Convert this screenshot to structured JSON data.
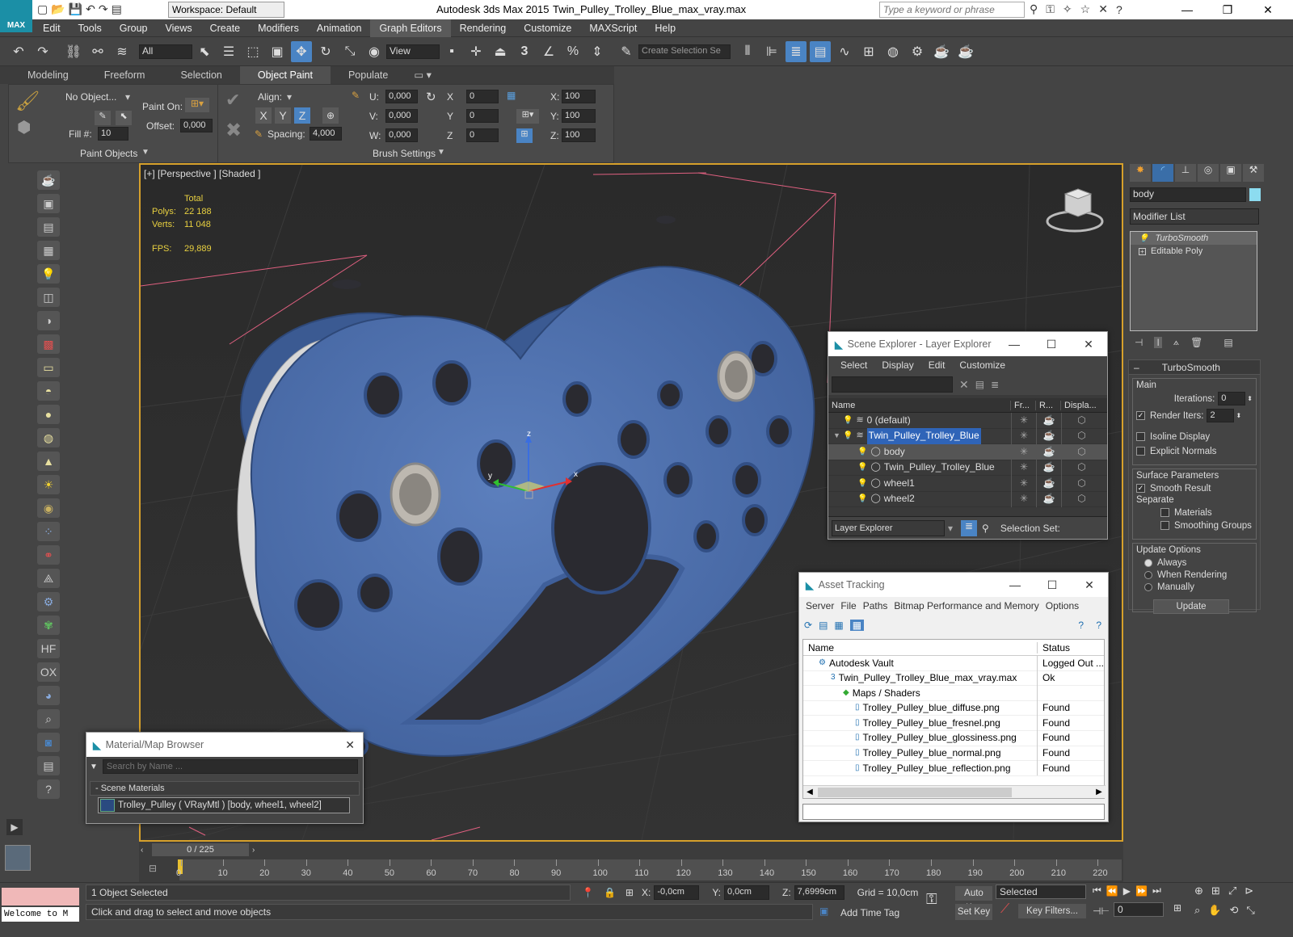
{
  "title_bar": {
    "workspace_label": "Workspace: Default",
    "app_title": "Autodesk 3ds Max  2015",
    "file_title": "Twin_Pulley_Trolley_Blue_max_vray.max",
    "search_placeholder": "Type a keyword or phrase"
  },
  "menu": [
    "Edit",
    "Tools",
    "Group",
    "Views",
    "Create",
    "Modifiers",
    "Animation",
    "Graph Editors",
    "Rendering",
    "Customize",
    "MAXScript",
    "Help"
  ],
  "menu_selected": "Graph Editors",
  "toolbar": {
    "selection_filter": "All",
    "ref_coord": "View",
    "create_selection_set": "Create Selection Se",
    "snap_3": "3"
  },
  "ribbon": {
    "tabs": [
      "Modeling",
      "Freeform",
      "Selection",
      "Object Paint",
      "Populate"
    ],
    "active_tab": "Object Paint",
    "no_object": "No Object...",
    "paint_on": "Paint On:",
    "offset_label": "Offset:",
    "offset_value": "0,000",
    "fill_label": "Fill #:",
    "fill_value": "10",
    "paint_objects": "Paint Objects",
    "align_label": "Align:",
    "x": "X",
    "y": "Y",
    "z": "Z",
    "spacing_label": "Spacing:",
    "spacing_value": "4,000",
    "brush_settings": "Brush Settings",
    "u_label": "U:",
    "v_label": "V:",
    "w_label": "W:",
    "u_value": "0,000",
    "v_value": "0,000",
    "w_value": "0,000",
    "rx_label": "X",
    "ry_label": "Y",
    "rz_label": "Z",
    "rx_value": "0",
    "ry_value": "0",
    "rz_value": "0",
    "sx_label": "X:",
    "sy_label": "Y:",
    "sz_label": "Z:",
    "sx_value": "100",
    "sy_value": "100",
    "sz_value": "100"
  },
  "viewport": {
    "label": "[+] [Perspective ] [Shaded ]",
    "stats_header": "Total",
    "polys_label": "Polys:",
    "polys_value": "22 188",
    "verts_label": "Verts:",
    "verts_value": "11 048",
    "fps_label": "FPS:",
    "fps_value": "29,889",
    "axis_x": "x",
    "axis_y": "y",
    "axis_z": "z"
  },
  "scene_explorer": {
    "title": "Scene Explorer - Layer Explorer",
    "menu": [
      "Select",
      "Display",
      "Edit",
      "Customize"
    ],
    "columns": [
      "Name",
      "Fr...",
      "R...",
      "Displa..."
    ],
    "rows": [
      {
        "name": "0 (default)",
        "indent": 0,
        "selected": false
      },
      {
        "name": "Twin_Pulley_Trolley_Blue",
        "indent": 0,
        "selected": true
      },
      {
        "name": "body",
        "indent": 1,
        "selected": false,
        "highlight": true
      },
      {
        "name": "Twin_Pulley_Trolley_Blue",
        "indent": 1,
        "selected": false
      },
      {
        "name": "wheel1",
        "indent": 1,
        "selected": false
      },
      {
        "name": "wheel2",
        "indent": 1,
        "selected": false
      }
    ],
    "footer_dropdown": "Layer Explorer",
    "footer_selection_set": "Selection Set:"
  },
  "asset_tracking": {
    "title": "Asset Tracking",
    "menu": [
      "Server",
      "File",
      "Paths",
      "Bitmap Performance and Memory",
      "Options"
    ],
    "columns": [
      "Name",
      "Status"
    ],
    "rows": [
      {
        "name": "Autodesk Vault",
        "status": "Logged Out ...",
        "indent": 1
      },
      {
        "name": "Twin_Pulley_Trolley_Blue_max_vray.max",
        "status": "Ok",
        "indent": 2
      },
      {
        "name": "Maps / Shaders",
        "status": "",
        "indent": 3
      },
      {
        "name": "Trolley_Pulley_blue_diffuse.png",
        "status": "Found",
        "indent": 4
      },
      {
        "name": "Trolley_Pulley_blue_fresnel.png",
        "status": "Found",
        "indent": 4
      },
      {
        "name": "Trolley_Pulley_blue_glossiness.png",
        "status": "Found",
        "indent": 4
      },
      {
        "name": "Trolley_Pulley_blue_normal.png",
        "status": "Found",
        "indent": 4
      },
      {
        "name": "Trolley_Pulley_blue_reflection.png",
        "status": "Found",
        "indent": 4
      }
    ]
  },
  "material_browser": {
    "title": "Material/Map Browser",
    "search_placeholder": "Search by Name ...",
    "group": "- Scene Materials",
    "item": "Trolley_Pulley  ( VRayMtl )  [body, wheel1, wheel2]"
  },
  "command_panel": {
    "object_name": "body",
    "modifier_list": "Modifier List",
    "stack": [
      "TurboSmooth",
      "Editable Poly"
    ],
    "rollout_title": "TurboSmooth",
    "main_group": "Main",
    "iterations_label": "Iterations:",
    "iterations_value": "0",
    "render_iters_label": "Render Iters:",
    "render_iters_value": "2",
    "render_iters_checked": true,
    "isoline_label": "Isoline Display",
    "explicit_label": "Explicit Normals",
    "surface_group": "Surface Parameters",
    "smooth_result_label": "Smooth Result",
    "separate_label": "Separate",
    "materials_label": "Materials",
    "smoothing_label": "Smoothing Groups",
    "update_group": "Update Options",
    "always_label": "Always",
    "when_rendering_label": "When Rendering",
    "manually_label": "Manually",
    "update_button": "Update"
  },
  "timeline": {
    "frame_display": "0 / 225",
    "ticks": [
      "0",
      "10",
      "20",
      "30",
      "40",
      "50",
      "60",
      "70",
      "80",
      "90",
      "100",
      "110",
      "120",
      "130",
      "140",
      "150",
      "160",
      "170",
      "180",
      "190",
      "200",
      "210",
      "220"
    ]
  },
  "status": {
    "welcome": "Welcome to M",
    "selected": "1 Object Selected",
    "prompt": "Click and drag to select and move objects",
    "x_label": "X:",
    "x_value": "-0,0cm",
    "y_label": "Y:",
    "y_value": "0,0cm",
    "z_label": "Z:",
    "z_value": "7,6999cm",
    "grid": "Grid = 10,0cm",
    "add_time_tag": "Add Time Tag",
    "auto_key": "Auto Key",
    "set_key": "Set Key",
    "selected_dropdown": "Selected",
    "key_filters": "Key Filters...",
    "frame_spinner": "0"
  },
  "colors": {
    "object_blue": "#4f73b0",
    "viewport_bg": "#2d2d2d",
    "active_border": "#d6a02b",
    "accent": "#4a84c4"
  }
}
